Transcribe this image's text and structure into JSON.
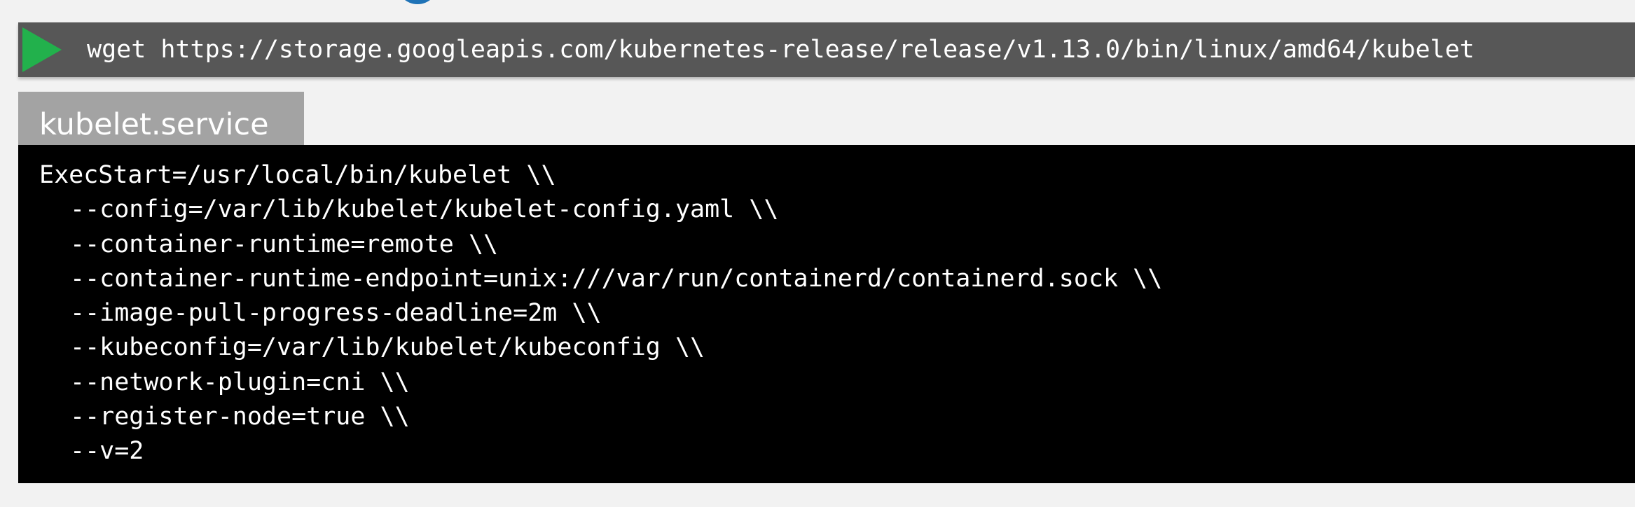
{
  "command_bar": {
    "run_icon": "play-icon",
    "command": "wget https://storage.googleapis.com/kubernetes-release/release/v1.13.0/bin/linux/amd64/kubelet"
  },
  "file": {
    "name": "kubelet.service",
    "lines": [
      "ExecStart=/usr/local/bin/kubelet \\\\",
      "--config=/var/lib/kubelet/kubelet-config.yaml \\\\",
      "--container-runtime=remote \\\\",
      "--container-runtime-endpoint=unix:///var/run/containerd/containerd.sock \\\\",
      "--image-pull-progress-deadline=2m \\\\",
      "--kubeconfig=/var/lib/kubelet/kubeconfig \\\\",
      "--network-plugin=cni \\\\",
      "--register-node=true \\\\",
      "--v=2"
    ]
  },
  "colors": {
    "page_background": "#f2f2f2",
    "command_bar": "#575757",
    "play_icon": "#22b14c",
    "file_tab": "#a3a3a3",
    "code_background": "#000000",
    "text": "#ffffff",
    "top_circle": "#1f73b7"
  }
}
